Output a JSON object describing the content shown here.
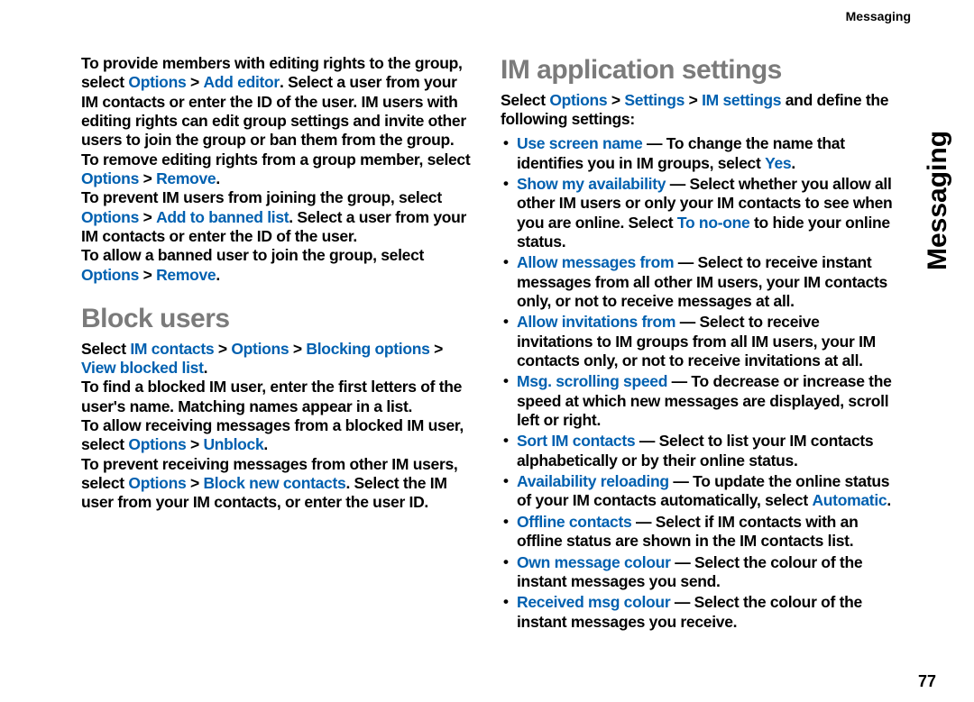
{
  "header": {
    "topic": "Messaging"
  },
  "sideTab": "Messaging",
  "pageNumber": "77",
  "left": {
    "intro1a": "To provide members with editing rights to the group, select ",
    "intro1_opt": "Options",
    "gt": " > ",
    "intro1_add": "Add editor",
    "intro1b": ". Select a user from your IM contacts or enter the ID of the user. IM users with editing rights can edit group settings and invite other users to join the group or ban them from the group.",
    "p2a": "To remove editing rights from a group member, select ",
    "p2_opt": "Options",
    "p2_rem": "Remove",
    "p3a": "To prevent IM users from joining the group, select ",
    "p3_opt": "Options",
    "p3_ban": "Add to banned list",
    "p3b": ". Select a user from your IM contacts or enter the ID of the user.",
    "p4a": "To allow a banned user to join the group, select ",
    "p4_opt": "Options",
    "p4_rem": "Remove",
    "h_block": "Block users",
    "b1a": "Select ",
    "b1_im": "IM contacts",
    "b1_opt": "Options",
    "b1_blk": "Blocking options",
    "b1_view": "View blocked list",
    "b2": "To find a blocked IM user, enter the first letters of the user's name. Matching names appear in a list.",
    "b3a": "To allow receiving messages from a blocked IM user, select ",
    "b3_opt": "Options",
    "b3_un": "Unblock",
    "b4a": "To prevent receiving messages from other IM users, select ",
    "b4_opt": "Options",
    "b4_blk": "Block new contacts",
    "b4b": ". Select the IM user from your IM contacts, or enter the user ID."
  },
  "right": {
    "h_im": "IM application settings",
    "lead_a": "Select ",
    "lead_opt": "Options",
    "lead_set": "Settings",
    "lead_im": "IM settings",
    "lead_b": " and define the following settings:",
    "items": [
      {
        "name": "Use screen name",
        "desc_a": " — To change the name that identifies you in IM groups, select ",
        "desc_hl": "Yes",
        "desc_b": "."
      },
      {
        "name": "Show my availability ",
        "desc_a": " — Select whether you allow all other IM users or only your IM contacts to see when you are online. Select ",
        "desc_hl": "To no-one",
        "desc_b": " to hide your online status."
      },
      {
        "name": "Allow messages from ",
        "desc_a": " — Select to receive instant messages from all other IM users, your IM contacts only, or not to receive messages at all.",
        "desc_hl": "",
        "desc_b": ""
      },
      {
        "name": "Allow invitations from",
        "desc_a": " — Select to receive invitations to IM groups from all IM users, your IM contacts only, or not to receive invitations at all.",
        "desc_hl": "",
        "desc_b": ""
      },
      {
        "name": "Msg. scrolling speed",
        "desc_a": " — To decrease or increase the speed at which new messages are displayed, scroll left or right.",
        "desc_hl": "",
        "desc_b": ""
      },
      {
        "name": "Sort IM contacts",
        "desc_a": " — Select to list your IM contacts alphabetically or by their online status.",
        "desc_hl": "",
        "desc_b": ""
      },
      {
        "name": "Availability reloading",
        "desc_a": " — To update the online status of your IM contacts automatically, select ",
        "desc_hl": "Automatic",
        "desc_b": "."
      },
      {
        "name": "Offline contacts",
        "desc_a": " — Select if IM contacts with an offline status are shown in the IM contacts list.",
        "desc_hl": "",
        "desc_b": ""
      },
      {
        "name": "Own message colour",
        "desc_a": " — Select the colour of the instant messages you send.",
        "desc_hl": "",
        "desc_b": ""
      },
      {
        "name": "Received msg colour",
        "desc_a": " — Select the colour of the instant messages you receive.",
        "desc_hl": "",
        "desc_b": ""
      }
    ]
  }
}
